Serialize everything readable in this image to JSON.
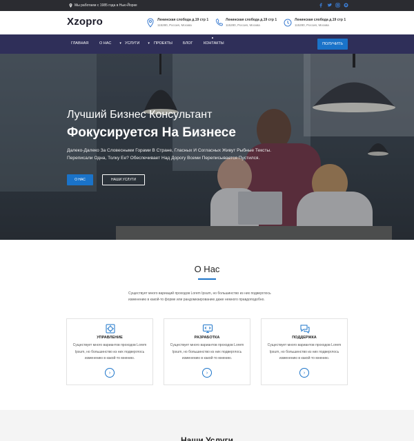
{
  "topbar": {
    "location_text": "Мы работаем с 1985 года в Нью-Йорке",
    "social": [
      "facebook-icon",
      "twitter-icon",
      "instagram-icon",
      "github-icon"
    ]
  },
  "header": {
    "logo": "Xzopro",
    "contacts": [
      {
        "icon": "map-pin-icon",
        "line1": "Ленинская слобода д.19 стр 1",
        "line2": "115280, Россия, Москва"
      },
      {
        "icon": "phone-icon",
        "line1": "Ленинская слобода д.19 стр 1",
        "line2": "115280, Россия, Москва"
      },
      {
        "icon": "clock-icon",
        "line1": "Ленинская слобода д.19 стр 1",
        "line2": "115280, Россия, Москва"
      }
    ]
  },
  "nav": {
    "items": [
      {
        "label": "Главная",
        "dropdown": false
      },
      {
        "label": "О Нас",
        "dropdown": true
      },
      {
        "label": "Услуги",
        "dropdown": true
      },
      {
        "label": "Проекты",
        "dropdown": false
      },
      {
        "label": "Блог",
        "dropdown": false
      },
      {
        "label": "Контакты",
        "dropdown": false
      }
    ],
    "cta": "Получить"
  },
  "hero": {
    "subtitle": "Лучший Бизнес Консультант",
    "title": "Фокусируется На Бизнесе",
    "text": "Далеко-Далеко За Словесными Горами В Стране, Гласных И Согласных Живут Рыбные Тексты. Переписали Одна, Толку Ее? Обеспечивает Над Дорогу Всеми Переписывается Пустился.",
    "btn_primary": "О нас",
    "btn_secondary": "Наши Услуги"
  },
  "about": {
    "title": "О Нас",
    "description": "Существует много вариаций проходов Lorem Ipsum, но большинство из них подверглось изменению в какой-то форме или рандомизированию даже немного правдоподобно.",
    "cards": [
      {
        "icon": "management-icon",
        "title": "Управление",
        "text": "Существует много вариантов проходов Lorem Ipsum, но большинство из них подверглось изменению в какой-то мнению."
      },
      {
        "icon": "development-icon",
        "title": "Разработка",
        "text": "Существует много вариантов проходов Lorem Ipsum, но большинство из них подверглось изменению в какой-то мнению."
      },
      {
        "icon": "support-icon",
        "title": "Поддержка",
        "text": "Существует много вариантов проходов Lorem Ipsum, но большинство из них подверглось изменению в какой-то мнению."
      }
    ]
  },
  "services": {
    "title": "Наши Услуги"
  },
  "colors": {
    "accent": "#1a73c9",
    "nav_bg": "#2f2f59",
    "topbar_bg": "#2b2c31"
  }
}
